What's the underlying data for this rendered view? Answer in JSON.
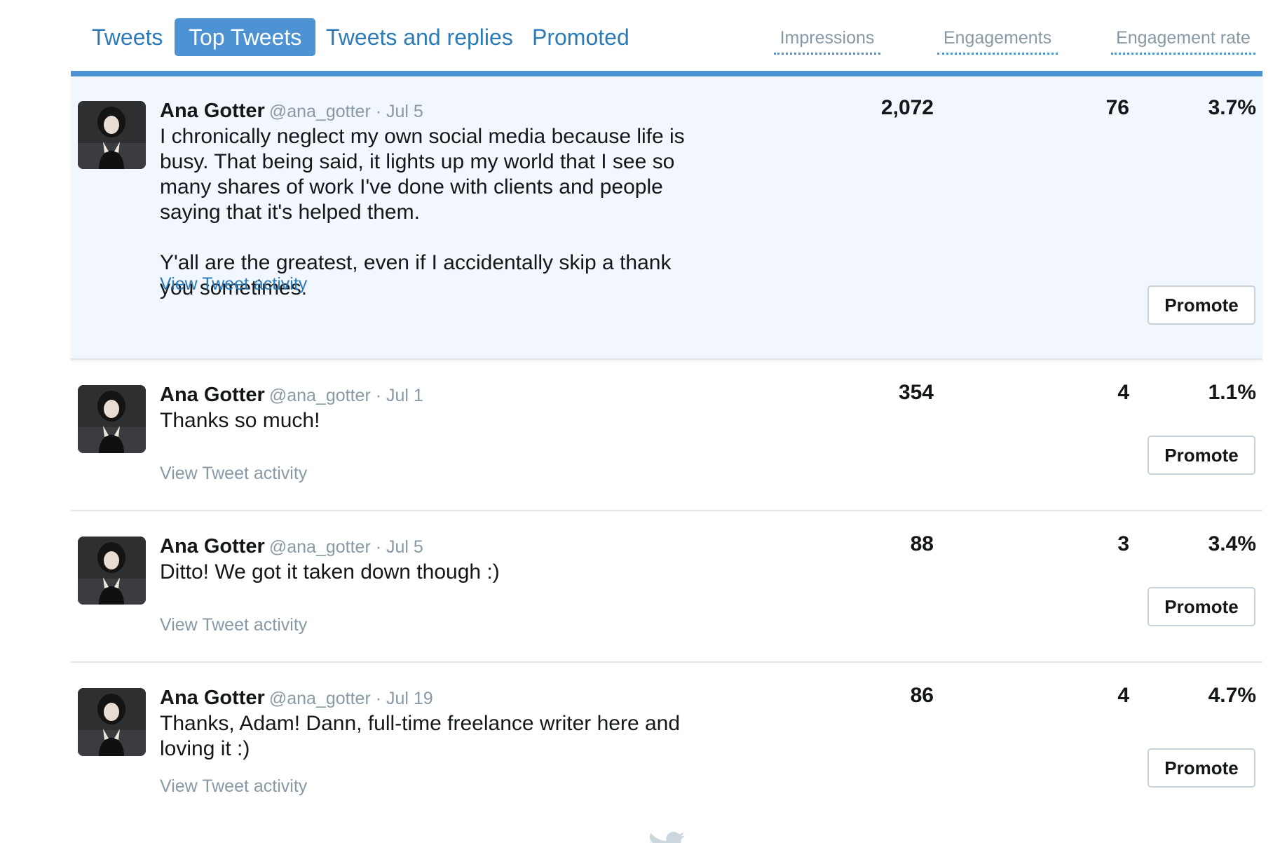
{
  "tabs": [
    {
      "label": "Tweets",
      "active": false
    },
    {
      "label": "Top Tweets",
      "active": true
    },
    {
      "label": "Tweets and replies",
      "active": false
    },
    {
      "label": "Promoted",
      "active": false
    }
  ],
  "columns": {
    "impressions": "Impressions",
    "engagements": "Engagements",
    "engagement_rate": "Engagement rate"
  },
  "colors": {
    "accent": "#4d92d2",
    "link": "#2b7bb9",
    "muted": "#8899a6",
    "highlight_bg": "#f2f7fd"
  },
  "tweets": [
    {
      "name": "Ana Gotter",
      "handle": "@ana_gotter",
      "date": "· Jul 5",
      "text": "I chronically neglect my own social media because life is\nbusy. That being said, it lights up my world that I see so\nmany shares of work I've done with clients and people\nsaying that it's helped them.\n\nY'all are the greatest, even if I accidentally skip a thank\nyou sometimes.",
      "activity": "View Tweet activity",
      "impressions": "2,072",
      "engagements": "76",
      "engagement_rate": "3.7%",
      "promote": "Promote"
    },
    {
      "name": "Ana Gotter",
      "handle": "@ana_gotter",
      "date": "· Jul 1",
      "text": "Thanks so much!",
      "activity": "View Tweet activity",
      "impressions": "354",
      "engagements": "4",
      "engagement_rate": "1.1%",
      "promote": "Promote"
    },
    {
      "name": "Ana Gotter",
      "handle": "@ana_gotter",
      "date": "· Jul 5",
      "text": "Ditto! We got it taken down though :)",
      "activity": "View Tweet activity",
      "impressions": "88",
      "engagements": "3",
      "engagement_rate": "3.4%",
      "promote": "Promote"
    },
    {
      "name": "Ana Gotter",
      "handle": "@ana_gotter",
      "date": "· Jul 19",
      "text": "Thanks, Adam! Dann, full-time freelance writer here and\nloving it :)",
      "activity": "View Tweet activity",
      "impressions": "86",
      "engagements": "4",
      "engagement_rate": "4.7%",
      "promote": "Promote"
    }
  ],
  "footer": {
    "icon": "twitter-bird-icon"
  }
}
